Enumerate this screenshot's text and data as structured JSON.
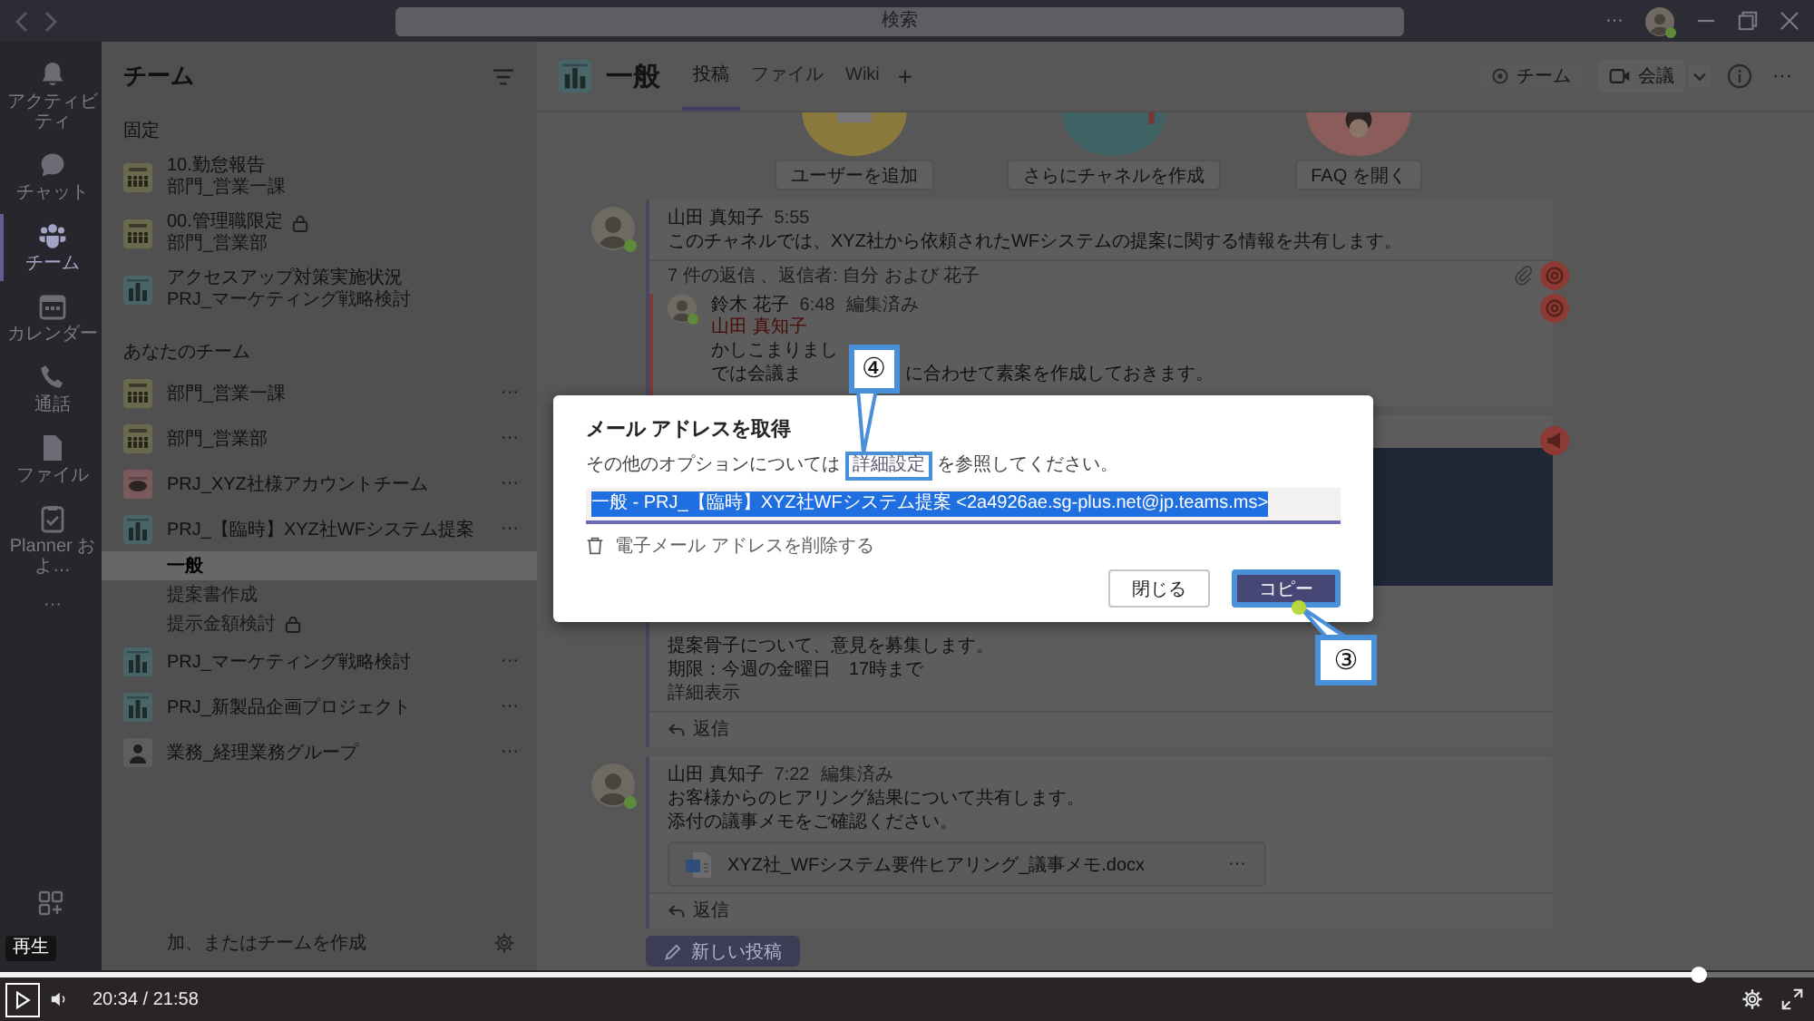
{
  "title_bar": {
    "search": {
      "placeholder": "検索"
    },
    "more": "···",
    "user": {
      "online": true
    }
  },
  "app_rail": {
    "items": [
      {
        "kind": "activity",
        "label": "アクティビティ",
        "selected": false
      },
      {
        "kind": "chat",
        "label": "チャット",
        "selected": false
      },
      {
        "kind": "teams",
        "label": "チーム",
        "selected": true
      },
      {
        "kind": "calendar",
        "label": "カレンダー",
        "selected": false
      },
      {
        "kind": "calls",
        "label": "通話",
        "selected": false
      },
      {
        "kind": "files",
        "label": "ファイル",
        "selected": false
      },
      {
        "kind": "planner",
        "label": "Planner およ…",
        "selected": false
      },
      {
        "kind": "more",
        "label": "···",
        "selected": false
      }
    ]
  },
  "teams_panel": {
    "title": "チーム",
    "pinned_heading": "固定",
    "pinned": [
      {
        "kind": "department",
        "name": "10.勤怠報告",
        "team": "部門_営業一課",
        "private": false
      },
      {
        "kind": "department",
        "name": "00.管理職限定",
        "team": "部門_営業部",
        "private": true
      },
      {
        "kind": "project",
        "name": "アクセスアップ対策実施状況",
        "team": "PRJ_マーケティング戦略検討",
        "private": false
      }
    ],
    "teams_heading": "あなたのチーム",
    "teams": [
      {
        "kind": "department",
        "name": "部門_営業一課",
        "more": "···"
      },
      {
        "kind": "department",
        "name": "部門_営業部",
        "more": "···"
      },
      {
        "kind": "account",
        "name": "PRJ_XYZ社様アカウントチーム",
        "more": "···"
      },
      {
        "kind": "project",
        "name": "PRJ_【臨時】XYZ社WFシステム提案",
        "more": "···",
        "channels": [
          {
            "name": "一般",
            "selected": true,
            "private": false
          },
          {
            "name": "提案書作成",
            "selected": false,
            "private": false
          },
          {
            "name": "提示金額検討",
            "selected": false,
            "private": true
          }
        ]
      },
      {
        "kind": "project",
        "name": "PRJ_マーケティング戦略検討",
        "more": "···"
      },
      {
        "kind": "project",
        "name": "PRJ_新製品企画プロジェクト",
        "more": "···"
      },
      {
        "kind": "business",
        "name": "業務_経理業務グループ",
        "more": "···"
      }
    ],
    "footer_link": "加、またはチームを作成"
  },
  "channel_header": {
    "name": "一般",
    "tabs": [
      {
        "label": "投稿",
        "selected": true
      },
      {
        "label": "ファイル",
        "selected": false
      },
      {
        "label": "Wiki",
        "selected": false
      }
    ],
    "add_tab": "+",
    "team_button": "チーム",
    "meet_button": "会議",
    "more": "···"
  },
  "welcome": {
    "actions": [
      "ユーザーを追加",
      "さらにチャネルを作成",
      "FAQ を開く"
    ]
  },
  "posts": [
    {
      "author": "山田 真知子",
      "online": true,
      "time": "5:55",
      "lines": [
        "このチャネルでは、XYZ社から依頼されたWFシステムの提案に関する情報を共有します。"
      ],
      "replies_summary": "7 件の返信 、返信者: 自分 および 花子",
      "attachment": true,
      "mentioned": true,
      "reply": {
        "author": "鈴木 花子",
        "online": true,
        "time": "6:48",
        "note": "編集済み",
        "mentioned": true,
        "mention": "山田 真知子",
        "lines": [
          [
            "かしこまりまし"
          ],
          [
            "では会議ま",
            "に合わせて素案を作成しておきます。"
          ]
        ]
      }
    },
    {
      "announcement": true,
      "image": true,
      "lines": [
        "提案骨子について、意見を募集します。",
        "期限：今週の金曜日　17時まで"
      ],
      "show_more": "詳細表示",
      "reply_button": "返信"
    },
    {
      "author": "山田 真知子",
      "online": true,
      "time": "7:22",
      "note": "編集済み",
      "lines": [
        "お客様からのヒアリング結果について共有します。",
        "添付の議事メモをご確認ください。"
      ],
      "file": {
        "name": "XYZ社_WFシステム要件ヒアリング_議事メモ.docx",
        "more": "···"
      },
      "reply_button": "返信"
    }
  ],
  "new_post_button": "新しい投稿",
  "dialog": {
    "title": "メール アドレスを取得",
    "hint_before": "その他のオプションについては ",
    "link": "詳細設定",
    "link_callout": "④",
    "hint_after": " を参照してください。",
    "address": {
      "value": "一般 - PRJ_【臨時】XYZ社WFシステム提案 <2a4926ae.sg-plus.net@jp.teams.ms>",
      "selected": true
    },
    "remove_link": "電子メール アドレスを削除する",
    "buttons": [
      {
        "kind": "close",
        "label": "閉じる"
      },
      {
        "kind": "copy",
        "label": "コピー",
        "callout": "③"
      }
    ]
  },
  "player": {
    "tooltip": "再生",
    "play_focused": true,
    "time": "20:34 / 21:58",
    "level": 0.936
  }
}
